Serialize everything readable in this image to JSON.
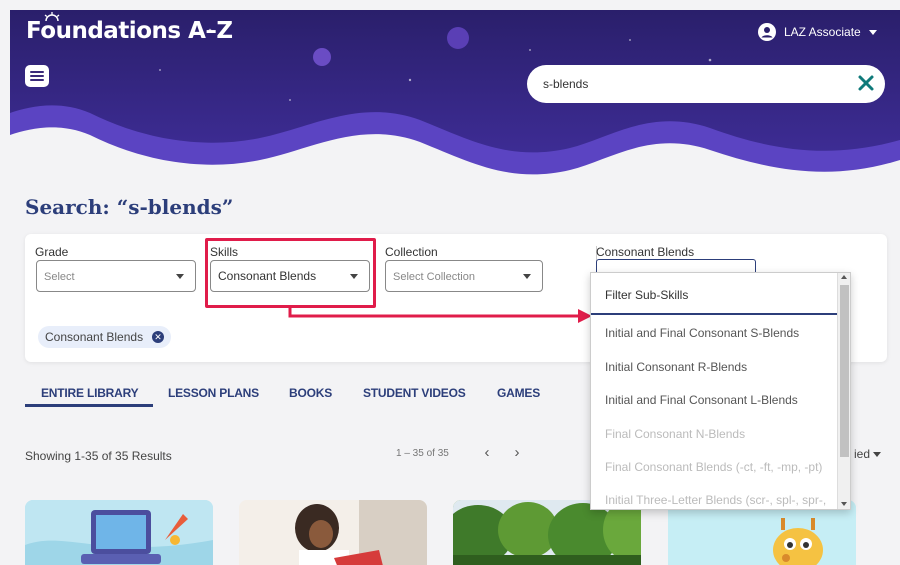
{
  "app": {
    "logo_text": "Foundations A–Z"
  },
  "header": {
    "user_label": "LAZ Associate",
    "search_value": "s-blends"
  },
  "page": {
    "title": "Search: “s-blends”"
  },
  "filters": {
    "grade": {
      "label": "Grade",
      "value": "Select"
    },
    "skills": {
      "label": "Skills",
      "value": "Consonant Blends"
    },
    "collection": {
      "label": "Collection",
      "value": "Select Collection"
    },
    "consonant_blends": {
      "label": "Consonant Blends"
    },
    "active_chip": "Consonant Blends"
  },
  "subskills_dropdown": {
    "filter_label": "Filter Sub-Skills",
    "items": [
      {
        "label": "Initial and Final Consonant S-Blends",
        "enabled": true
      },
      {
        "label": "Initial Consonant R-Blends",
        "enabled": true
      },
      {
        "label": "Initial and Final Consonant L-Blends",
        "enabled": true
      },
      {
        "label": "Final Consonant N-Blends",
        "enabled": false
      },
      {
        "label": "Final Consonant Blends (-ct, -ft, -mp, -pt)",
        "enabled": false
      },
      {
        "label": "Initial Three-Letter Blends (scr-, spl-, spr-,",
        "enabled": false
      }
    ]
  },
  "tabs": [
    {
      "label": "ENTIRE LIBRARY",
      "active": true
    },
    {
      "label": "LESSON PLANS",
      "active": false
    },
    {
      "label": "BOOKS",
      "active": false
    },
    {
      "label": "STUDENT VIDEOS",
      "active": false
    },
    {
      "label": "GAMES",
      "active": false
    }
  ],
  "results": {
    "summary": "Showing 1-35 of 35 Results",
    "pager": "1 – 35 of 35",
    "prev": "‹",
    "next": "›",
    "sort_partial": "ied"
  },
  "colors": {
    "hero_dark": "#2a1f6b",
    "hero_purple": "#4b34a8",
    "brand_navy": "#2c3e7a",
    "highlight_red": "#e01c4a",
    "close_teal": "#0f7a7a"
  }
}
